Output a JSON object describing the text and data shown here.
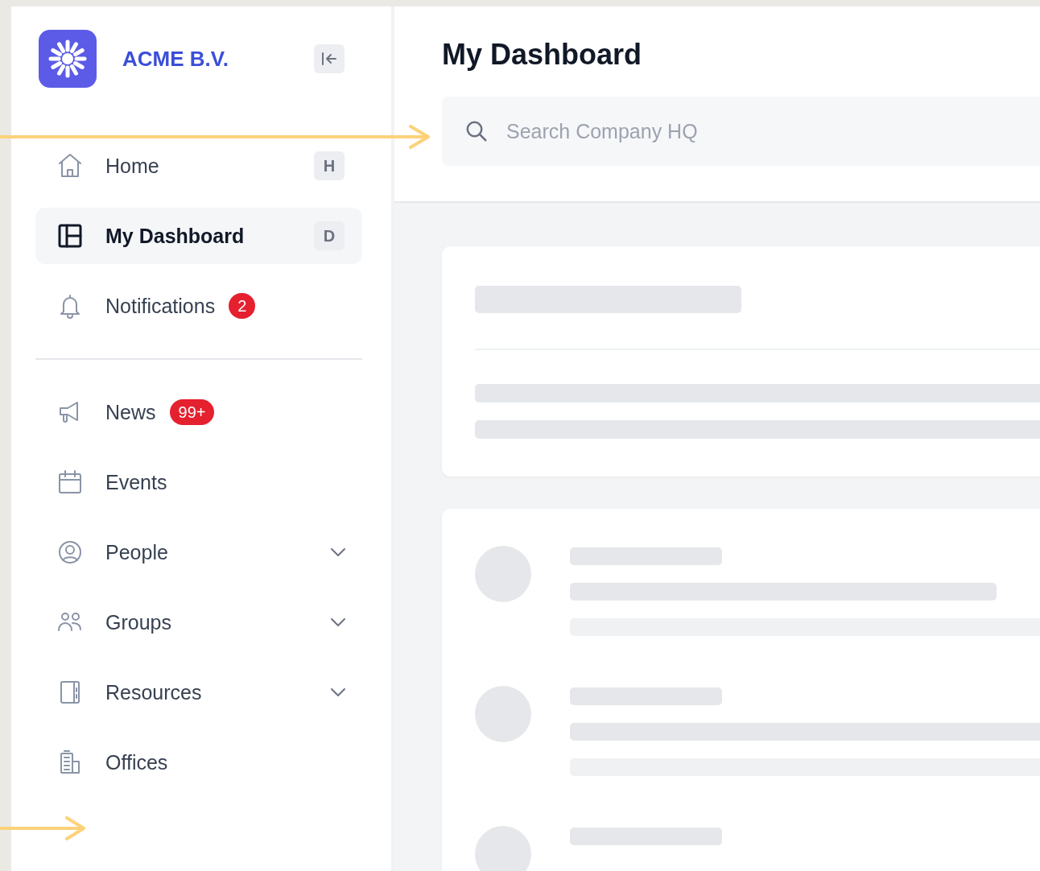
{
  "sidebar": {
    "brand": "ACME B.V.",
    "sections": [
      [
        {
          "label": "Home",
          "shortcut": "H",
          "selected": false,
          "expandable": false
        },
        {
          "label": "My Dashboard",
          "shortcut": "D",
          "selected": true,
          "expandable": false
        },
        {
          "label": "Notifications",
          "badge": "2",
          "selected": false,
          "expandable": false
        }
      ],
      [
        {
          "label": "News",
          "badge": "99+",
          "selected": false,
          "expandable": false
        },
        {
          "label": "Events",
          "selected": false,
          "expandable": false
        },
        {
          "label": "People",
          "selected": false,
          "expandable": true
        },
        {
          "label": "Groups",
          "selected": false,
          "expandable": true
        },
        {
          "label": "Resources",
          "selected": false,
          "expandable": true
        },
        {
          "label": "Offices",
          "selected": false,
          "expandable": false
        }
      ]
    ]
  },
  "main": {
    "title": "My Dashboard",
    "search": {
      "placeholder": "Search Company HQ"
    },
    "cards": [
      {
        "kind": "text-block"
      },
      {
        "kind": "list"
      }
    ]
  }
}
